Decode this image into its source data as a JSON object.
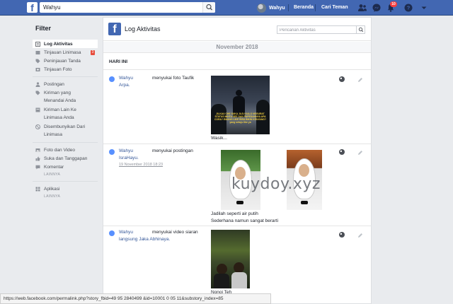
{
  "topbar": {
    "search_value": "Wahyu",
    "user_name": "Wahyu",
    "home_label": "Beranda",
    "find_friends_label": "Cari Teman",
    "notification_count": "10",
    "bar_color": "#4267b2"
  },
  "sidebar": {
    "title": "Filter",
    "groups": [
      {
        "items": [
          {
            "label": "Log Aktivitas",
            "icon": "log-icon",
            "active": true
          },
          {
            "label": "Tinjauan Linimasa",
            "icon": "timeline-review-icon",
            "count": "3"
          },
          {
            "label": "Peninjauan Tanda",
            "icon": "tag-review-icon"
          },
          {
            "label": "Tinjauan Foto",
            "icon": "photo-review-icon"
          }
        ]
      },
      {
        "items": [
          {
            "label": "Postingan",
            "icon": "person-icon"
          },
          {
            "label": "Kiriman yang",
            "sub": "Menandai Anda",
            "icon": "tag-icon"
          },
          {
            "label": "Kiriman Lain Ke",
            "sub": "Linimasa Anda",
            "icon": "post-icon"
          },
          {
            "label": "Disembunyikan Dari",
            "sub": "Linimasa",
            "icon": "hidden-icon"
          }
        ]
      },
      {
        "items": [
          {
            "label": "Foto dan Video",
            "icon": "photo-icon"
          },
          {
            "label": "Suka dan Tanggapan",
            "icon": "like-icon"
          },
          {
            "label": "Komentar",
            "icon": "comment-icon"
          }
        ],
        "more": "LAINNYA"
      },
      {
        "items": [
          {
            "label": "Aplikasi",
            "icon": "apps-icon"
          }
        ],
        "more": "LAINNYA"
      }
    ]
  },
  "main": {
    "title": "Log Aktivitas",
    "search_placeholder": "Pencarian Aktivitas",
    "month": "November 2018",
    "day": "HARI INI",
    "entries": [
      {
        "actor": "Wahyu",
        "verb": "menyukai foto Taufik",
        "line2": "Arpa.",
        "caption": "Wasik..."
      },
      {
        "actor": "Wahyu",
        "verb": "menyukai postingan",
        "line2": "IsraHayu.",
        "date": "19 November 2018 18:23",
        "caption1": "Jadilah seperti air putih",
        "caption2": "Sederhana namun sangat berarti"
      },
      {
        "actor": "Wahyu",
        "verb": "menyukai video siaran",
        "line2": "langsung Jaka Abhinaya.",
        "caption": "Nonoi Teh"
      }
    ],
    "photo_quote": "JILKAU CHE SUKA JUJU KALO NEGURAT STATUS MINTA SEE DAN PAPEDAHNYA APA CORA? EMANG LIKE BISA BIKIN KENYANG? yang setuju like ya"
  },
  "watermark": "kuydoy.xyz",
  "status_url": "https://web.facebook.com/permalink.php?story_fbid=49  95  2840499    &id=10001  0  05      11&substory_index=85"
}
